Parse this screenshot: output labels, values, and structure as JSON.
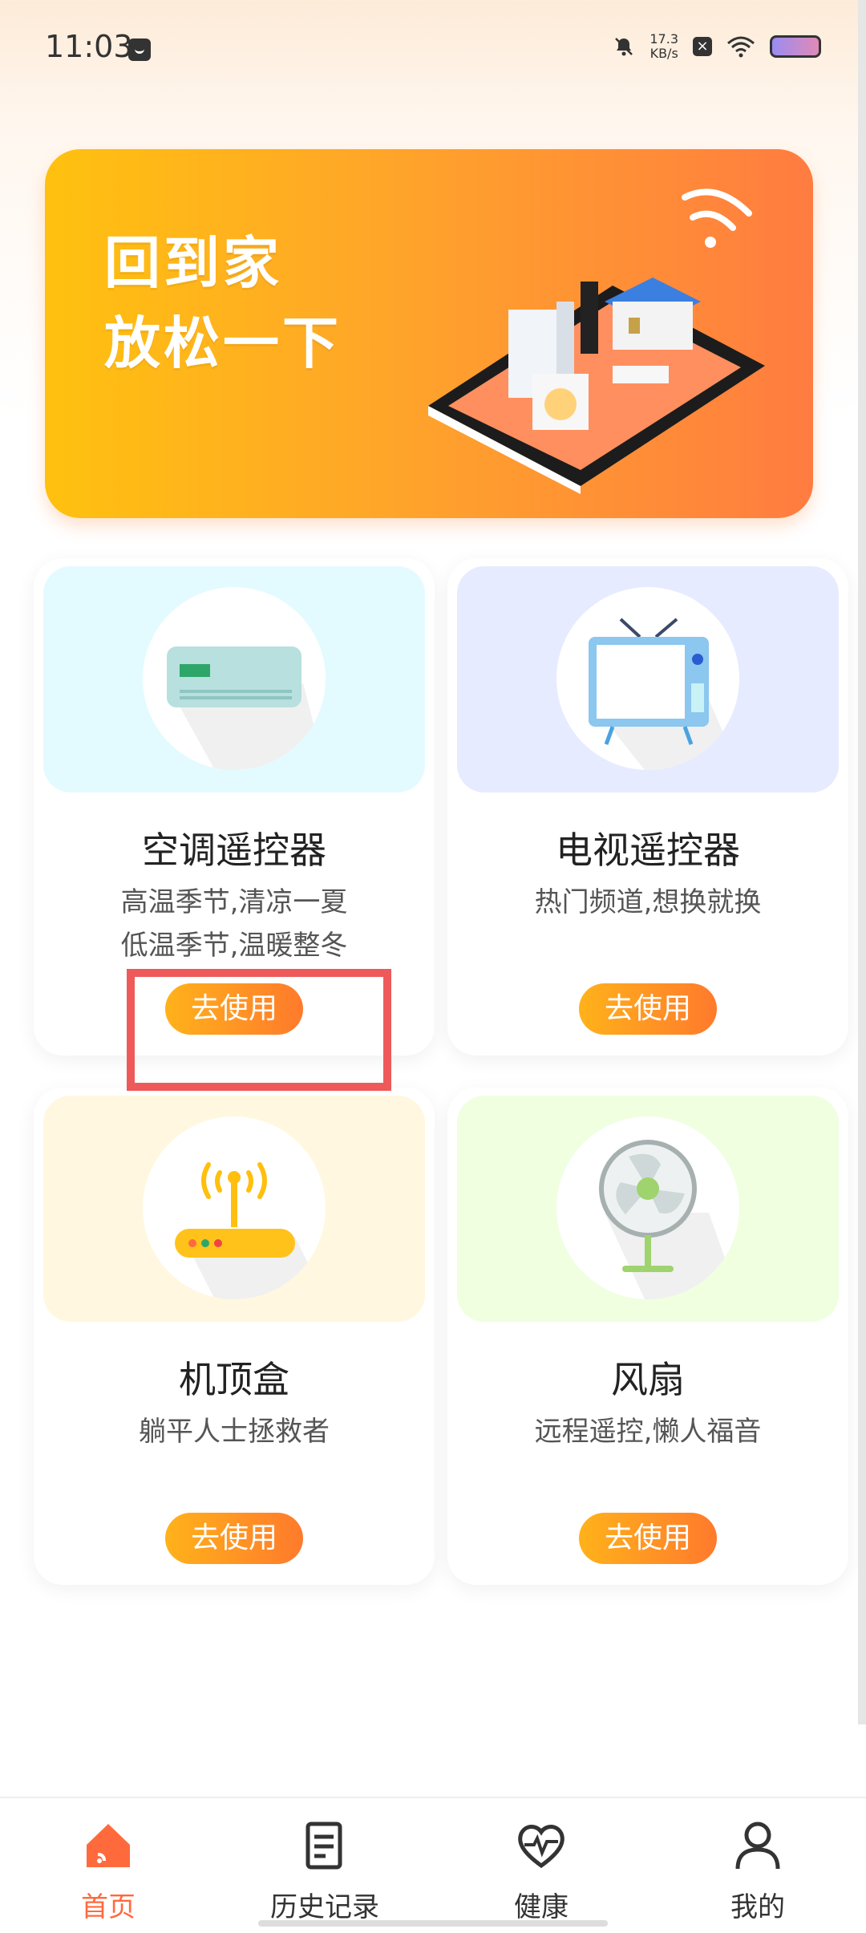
{
  "status_bar": {
    "time": "11:03",
    "network_speed_value": "17.3",
    "network_speed_unit": "KB/s"
  },
  "banner": {
    "line1": "回到家",
    "line2": "放松一下"
  },
  "cards": [
    {
      "title": "空调遥控器",
      "desc1": "高温季节,清凉一夏",
      "desc2": "低温季节,温暖整冬",
      "button": "去使用",
      "icon": "air-conditioner-icon",
      "bg": "#e3fbff"
    },
    {
      "title": "电视遥控器",
      "desc1": "热门频道,想换就换",
      "desc2": "",
      "button": "去使用",
      "icon": "tv-icon",
      "bg": "#e6ebff"
    },
    {
      "title": "机顶盒",
      "desc1": "躺平人士拯救者",
      "desc2": "",
      "button": "去使用",
      "icon": "set-top-box-icon",
      "bg": "#fff7df"
    },
    {
      "title": "风扇",
      "desc1": "远程遥控,懒人福音",
      "desc2": "",
      "button": "去使用",
      "icon": "fan-icon",
      "bg": "#efffe0"
    }
  ],
  "nav": [
    {
      "label": "首页",
      "icon": "home-icon",
      "active": true
    },
    {
      "label": "历史记录",
      "icon": "history-icon",
      "active": false
    },
    {
      "label": "健康",
      "icon": "health-icon",
      "active": false
    },
    {
      "label": "我的",
      "icon": "profile-icon",
      "active": false
    }
  ],
  "colors": {
    "accent": "#ff6a3d",
    "button_start": "#ffb21a",
    "button_end": "#ff7a2c",
    "highlight": "#ee5a5a"
  }
}
